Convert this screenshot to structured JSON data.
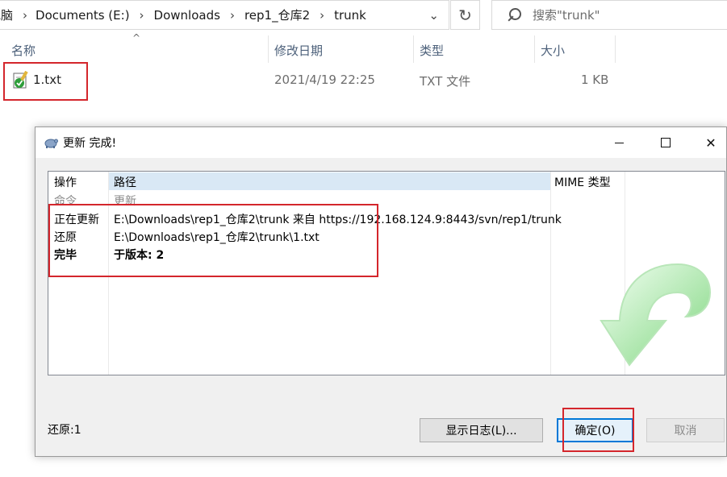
{
  "explorer": {
    "breadcrumb": [
      "电脑",
      "Documents (E:)",
      "Downloads",
      "rep1_仓库2",
      "trunk"
    ],
    "search_placeholder": "搜索\"trunk\"",
    "columns": {
      "name": "名称",
      "modified": "修改日期",
      "type": "类型",
      "size": "大小"
    },
    "files": [
      {
        "name": "1.txt",
        "modified": "2021/4/19 22:25",
        "type": "TXT 文件",
        "size": "1 KB"
      }
    ]
  },
  "dialog": {
    "title": "更新 完成!",
    "columns": {
      "action": "操作",
      "path": "路径",
      "mime": "MIME 类型"
    },
    "rows": [
      {
        "action": "命令",
        "path": "更新"
      },
      {
        "action": "正在更新",
        "path": "E:\\Downloads\\rep1_仓库2\\trunk 来自 https://192.168.124.9:8443/svn/rep1/trunk"
      },
      {
        "action": "还原",
        "path": "E:\\Downloads\\rep1_仓库2\\trunk\\1.txt"
      },
      {
        "action": "完毕",
        "path": "于版本: 2"
      }
    ],
    "status": "还原:1",
    "buttons": {
      "show_log": "显示日志(L)...",
      "ok": "确定(O)",
      "cancel": "取消"
    }
  },
  "colors": {
    "highlight_red": "#d4262c",
    "header_blue": "#d9e8f5",
    "accent": "#0078d7",
    "arrow_green": "#7ed67e"
  }
}
